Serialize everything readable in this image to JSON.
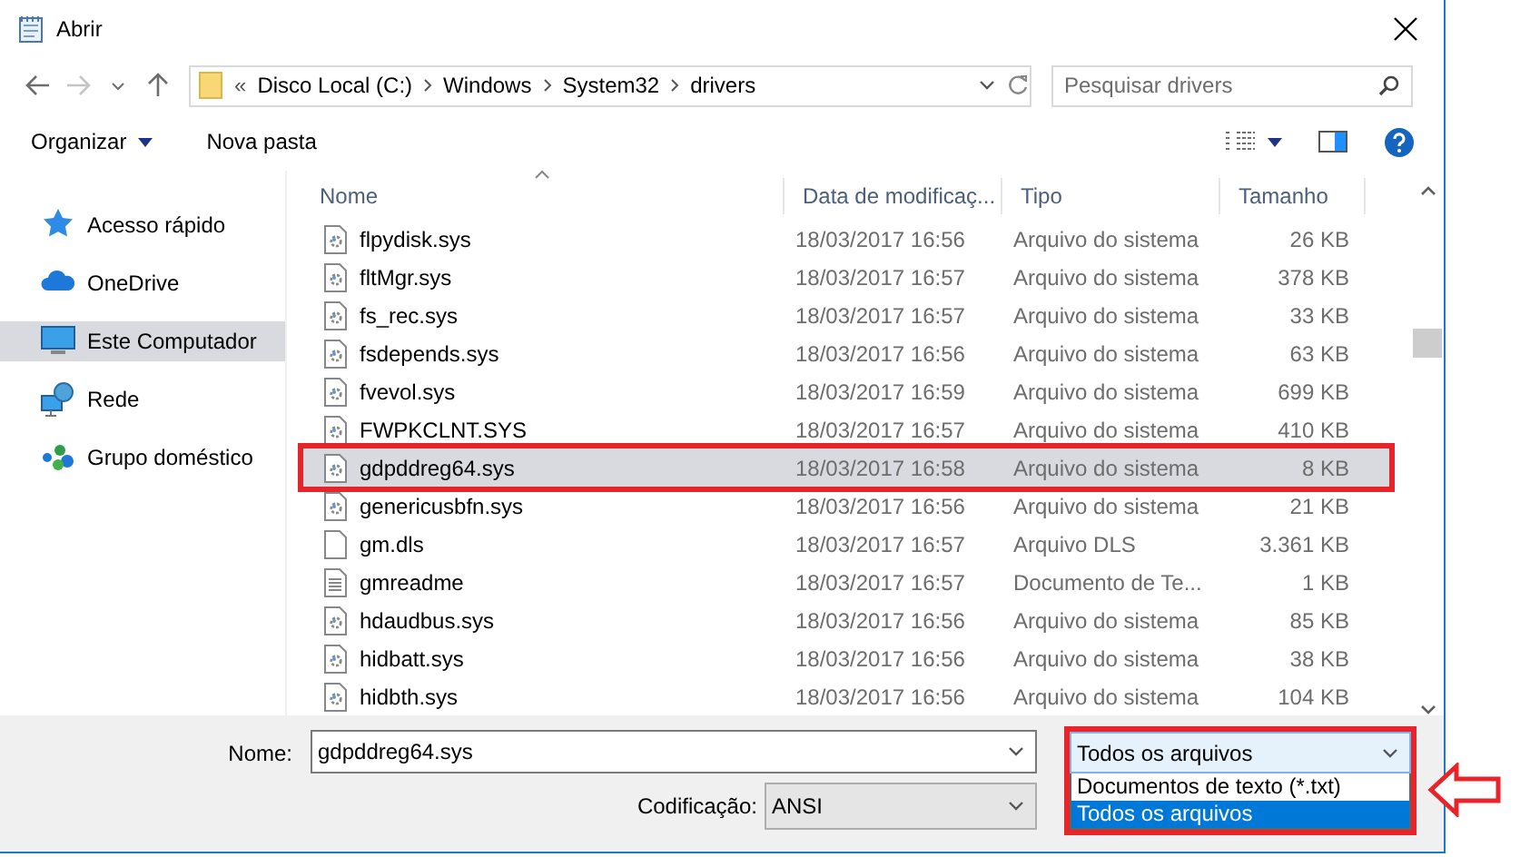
{
  "window": {
    "title": "Abrir"
  },
  "nav": {
    "overflow": "«",
    "path": [
      "Disco Local (C:)",
      "Windows",
      "System32",
      "drivers"
    ]
  },
  "search": {
    "placeholder": "Pesquisar drivers"
  },
  "toolbar": {
    "organize": "Organizar",
    "new_folder": "Nova pasta"
  },
  "sidebar": {
    "items": [
      {
        "label": "Acesso rápido",
        "selected": false
      },
      {
        "label": "OneDrive",
        "selected": false
      },
      {
        "label": "Este Computador",
        "selected": true
      },
      {
        "label": "Rede",
        "selected": false
      },
      {
        "label": "Grupo doméstico",
        "selected": false
      }
    ]
  },
  "table": {
    "columns": [
      "Nome",
      "Data de modificaç...",
      "Tipo",
      "Tamanho"
    ],
    "rows": [
      {
        "name": "flpydisk.sys",
        "date": "18/03/2017 16:56",
        "type": "Arquivo do sistema",
        "size": "26 KB",
        "kind": "system",
        "selected": false,
        "annotated": false
      },
      {
        "name": "fltMgr.sys",
        "date": "18/03/2017 16:57",
        "type": "Arquivo do sistema",
        "size": "378 KB",
        "kind": "system",
        "selected": false,
        "annotated": false
      },
      {
        "name": "fs_rec.sys",
        "date": "18/03/2017 16:57",
        "type": "Arquivo do sistema",
        "size": "33 KB",
        "kind": "system",
        "selected": false,
        "annotated": false
      },
      {
        "name": "fsdepends.sys",
        "date": "18/03/2017 16:56",
        "type": "Arquivo do sistema",
        "size": "63 KB",
        "kind": "system",
        "selected": false,
        "annotated": false
      },
      {
        "name": "fvevol.sys",
        "date": "18/03/2017 16:59",
        "type": "Arquivo do sistema",
        "size": "699 KB",
        "kind": "system",
        "selected": false,
        "annotated": false
      },
      {
        "name": "FWPKCLNT.SYS",
        "date": "18/03/2017 16:57",
        "type": "Arquivo do sistema",
        "size": "410 KB",
        "kind": "system",
        "selected": false,
        "annotated": false
      },
      {
        "name": "gdpddreg64.sys",
        "date": "18/03/2017 16:58",
        "type": "Arquivo do sistema",
        "size": "8 KB",
        "kind": "system",
        "selected": true,
        "annotated": true
      },
      {
        "name": "genericusbfn.sys",
        "date": "18/03/2017 16:56",
        "type": "Arquivo do sistema",
        "size": "21 KB",
        "kind": "system",
        "selected": false,
        "annotated": false
      },
      {
        "name": "gm.dls",
        "date": "18/03/2017 16:57",
        "type": "Arquivo DLS",
        "size": "3.361 KB",
        "kind": "blank",
        "selected": false,
        "annotated": false
      },
      {
        "name": "gmreadme",
        "date": "18/03/2017 16:57",
        "type": "Documento de Te...",
        "size": "1 KB",
        "kind": "text",
        "selected": false,
        "annotated": false
      },
      {
        "name": "hdaudbus.sys",
        "date": "18/03/2017 16:56",
        "type": "Arquivo do sistema",
        "size": "85 KB",
        "kind": "system",
        "selected": false,
        "annotated": false
      },
      {
        "name": "hidbatt.sys",
        "date": "18/03/2017 16:56",
        "type": "Arquivo do sistema",
        "size": "38 KB",
        "kind": "system",
        "selected": false,
        "annotated": false
      },
      {
        "name": "hidbth.sys",
        "date": "18/03/2017 16:56",
        "type": "Arquivo do sistema",
        "size": "104 KB",
        "kind": "system",
        "selected": false,
        "annotated": false
      }
    ]
  },
  "footer": {
    "name_label": "Nome:",
    "name_value": "gdpddreg64.sys",
    "encoding_label": "Codificação:",
    "encoding_value": "ANSI",
    "filter": {
      "value": "Todos os arquivos",
      "annotated": true,
      "options": [
        {
          "label": "Documentos de texto (*.txt)",
          "selected": false
        },
        {
          "label": "Todos os arquivos",
          "selected": true
        }
      ]
    }
  }
}
